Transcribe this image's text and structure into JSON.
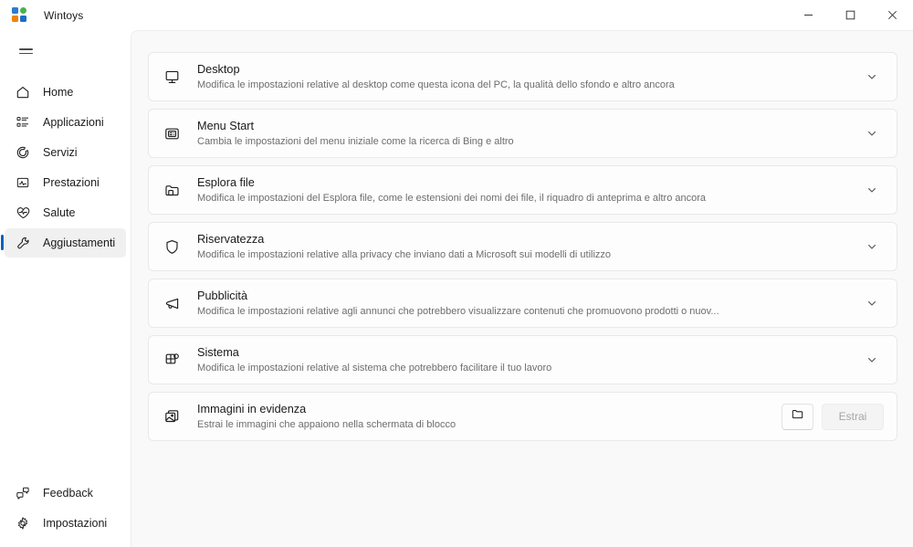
{
  "window": {
    "app_title": "Wintoys",
    "logo_colors": [
      "#2b7cd3",
      "#4cb050",
      "#f2820a",
      "#1e6fc4"
    ],
    "controls": {
      "minimize": "minimize-icon",
      "maximize": "maximize-icon",
      "close": "close-icon"
    }
  },
  "sidebar": {
    "menu_toggle": "hamburger-icon",
    "accent_color": "#0d5fb8",
    "items": [
      {
        "label": "Home",
        "icon": "home-icon",
        "selected": false
      },
      {
        "label": "Applicazioni",
        "icon": "apps-list-icon",
        "selected": false
      },
      {
        "label": "Servizi",
        "icon": "services-gear-icon",
        "selected": false
      },
      {
        "label": "Prestazioni",
        "icon": "performance-chart-icon",
        "selected": false
      },
      {
        "label": "Salute",
        "icon": "health-heart-pulse-icon",
        "selected": false
      },
      {
        "label": "Aggiustamenti",
        "icon": "tweaks-wrench-icon",
        "selected": true
      }
    ],
    "bottom_items": [
      {
        "label": "Feedback",
        "icon": "feedback-chat-icon"
      },
      {
        "label": "Impostazioni",
        "icon": "settings-gear-icon"
      }
    ]
  },
  "main": {
    "cards": [
      {
        "title": "Desktop",
        "subtitle": "Modifica le impostazioni relative al desktop come questa icona del PC, la qualità dello sfondo e altro ancora",
        "icon": "monitor-icon",
        "expander": "chevron-down-icon"
      },
      {
        "title": "Menu Start",
        "subtitle": "Cambia le impostazioni del menu iniziale come la ricerca di Bing e altro",
        "icon": "start-menu-icon",
        "expander": "chevron-down-icon"
      },
      {
        "title": "Esplora file",
        "subtitle": "Modifica le impostazioni del Esplora file, come le estensioni dei nomi dei file, il riquadro di anteprima e altro ancora",
        "icon": "folder-icon",
        "expander": "chevron-down-icon"
      },
      {
        "title": "Riservatezza",
        "subtitle": "Modifica le impostazioni relative alla privacy che inviano dati a Microsoft sui modelli di utilizzo",
        "icon": "shield-icon",
        "expander": "chevron-down-icon"
      },
      {
        "title": "Pubblicità",
        "subtitle": "Modifica le impostazioni relative agli annunci che potrebbero visualizzare contenuti che promuovono prodotti o nuov...",
        "icon": "megaphone-icon",
        "expander": "chevron-down-icon"
      },
      {
        "title": "Sistema",
        "subtitle": "Modifica le impostazioni relative al sistema che potrebbero facilitare il tuo lavoro",
        "icon": "system-window-grid-icon",
        "expander": "chevron-down-icon"
      }
    ],
    "spotlight_card": {
      "title": "Immagini in evidenza",
      "subtitle": "Estrai le immagini che appaiono nella schermata di blocco",
      "icon": "image-stack-icon",
      "browse_icon": "folder-open-icon",
      "extract_label": "Estrai",
      "extract_disabled": true
    }
  }
}
